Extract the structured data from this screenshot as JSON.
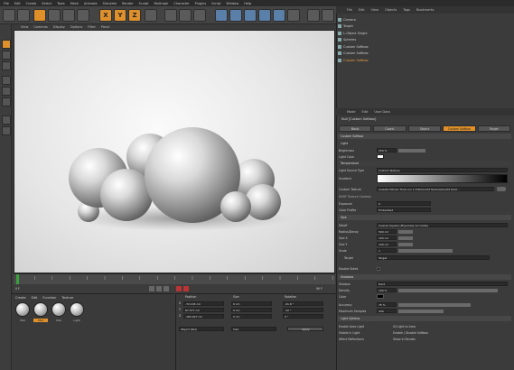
{
  "menu": [
    "File",
    "Edit",
    "Create",
    "Select",
    "Tools",
    "Mesh",
    "Animate",
    "Simulate",
    "Render",
    "Sculpt",
    "MoGraph",
    "Character",
    "Plugins",
    "Script",
    "Window",
    "Help"
  ],
  "axes": {
    "x": "X",
    "y": "Y",
    "z": "Z"
  },
  "view_menu": [
    "View",
    "Cameras",
    "Display",
    "Options",
    "Filter",
    "Panel"
  ],
  "objects": {
    "menu": [
      "File",
      "Edit",
      "View",
      "Objects",
      "Tags",
      "Bookmarks"
    ],
    "items": [
      {
        "name": "Camera",
        "selected": false
      },
      {
        "name": "Target",
        "selected": false
      },
      {
        "name": "L-Object Single",
        "selected": false
      },
      {
        "name": "Spheres",
        "selected": false
      },
      {
        "name": "Custom Softbox",
        "selected": false
      },
      {
        "name": "Custom Softbox",
        "selected": false
      },
      {
        "name": "Custom Softbox",
        "selected": true
      }
    ]
  },
  "attributes": {
    "menu": [
      "Mode",
      "Edit",
      "User Data"
    ],
    "object_title": "Null [Custom Softbox]",
    "tabs": [
      "Basic",
      "Coord.",
      "Object",
      "Custom Softbox",
      "Target"
    ],
    "active_tab": "Custom Softbox",
    "section_main": "Custom Softbox",
    "section_light": "Light",
    "brightness_label": "Brightness",
    "brightness": "250 %",
    "light_color_label": "Light Color",
    "temp_label": "Temperature",
    "source_label": "Light Source Type",
    "source": "Custom Texture",
    "gradient_label": "Gradient",
    "texture_label": "Custom Texture",
    "texture": "presets:\\Studio Tools pro 1.0\\Tex\\Light Textures\\Light Spot...",
    "hdrf_label": "HDRF Texture Controls",
    "exposure_label": "Exposure",
    "exposure": "0",
    "color_profile_label": "Color Profile",
    "color_profile": "Embedded",
    "section_size": "Size",
    "falloff_label": "Falloff",
    "falloff": "Inverse Square (Physically Accurate)",
    "radius_label": "Radius/Decay",
    "radius": "500 cm",
    "size_x_label": "Size X",
    "size_x": "100 cm",
    "size_y_label": "Size Y",
    "size_y": "100 cm",
    "scale_label": "Scale",
    "scale": "1",
    "target_label": "Target",
    "target": "Target",
    "double_sided_label": "Double Sided",
    "section_shadow": "Shadows",
    "shadow_label": "Shadow",
    "shadow": "Hard",
    "density_label": "Density",
    "density": "100 %",
    "sh_color_label": "Color",
    "accuracy_label": "Accuracy",
    "accuracy": "75 %",
    "samples_label": "Maximum Samples",
    "samples": "200",
    "section_options": "Light Options",
    "opt1": "Enable Area Light",
    "opt2": "Visible in Light",
    "opt3": "Affect Reflections",
    "opt4": "GI Light to Area",
    "opt5": "Enable / Disable Softbox",
    "opt6": "Show in Render"
  },
  "materials": {
    "menu": [
      "Create",
      "Edit",
      "Function",
      "Texture"
    ],
    "items": [
      {
        "label": "Mat",
        "selected": false
      },
      {
        "label": "Mat",
        "selected": true
      },
      {
        "label": "Mat",
        "selected": false
      },
      {
        "label": "Light",
        "selected": false
      }
    ]
  },
  "coordinates": {
    "headers": [
      "Position",
      "Size",
      "Rotation"
    ],
    "rows": [
      {
        "axis": "X",
        "pos": "-72.145 cm",
        "size": "0 cm",
        "rot": "-21.8 °"
      },
      {
        "axis": "Y",
        "pos": "67.577 cm",
        "size": "0 cm",
        "rot": "-10 °"
      },
      {
        "axis": "Z",
        "pos": "-165.027 cm",
        "size": "0 cm",
        "rot": "0 °"
      }
    ],
    "mode": "Object (Rel)",
    "size_mode": "Size",
    "apply": "Apply"
  },
  "timeline": {
    "start": "0 F",
    "end": "90 F"
  },
  "colors": {
    "accent": "#e0902a",
    "panel": "#3b3b3b"
  }
}
